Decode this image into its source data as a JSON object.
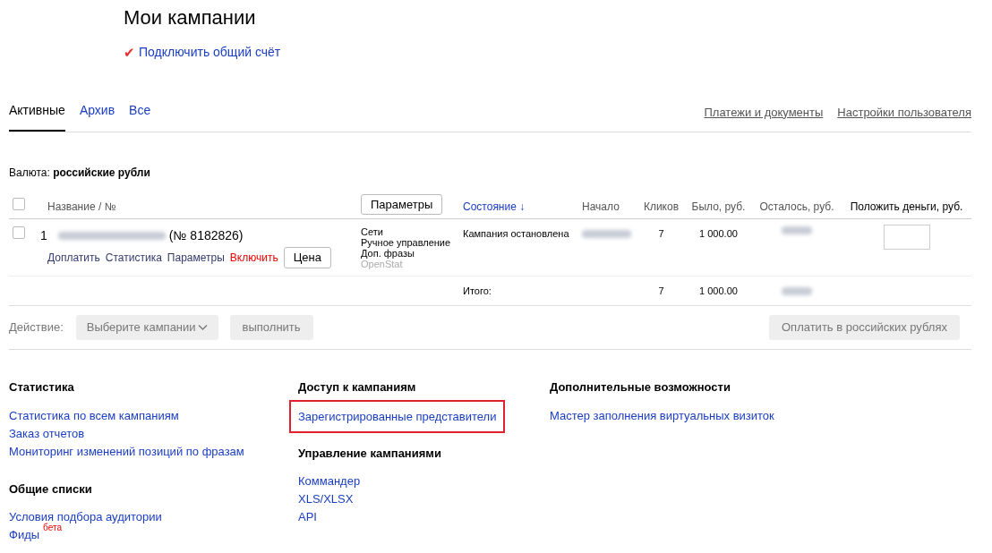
{
  "title": "Мои кампании",
  "connect_link": {
    "icon": "✔",
    "label": "Подключить общий счёт"
  },
  "tabs": [
    {
      "label": "Активные",
      "selected": true
    },
    {
      "label": "Архив",
      "selected": false
    },
    {
      "label": "Все",
      "selected": false
    }
  ],
  "header_links": [
    "Платежи и документы",
    "Настройки пользователя"
  ],
  "currency": {
    "label": "Валюта:",
    "value": "российские рубли"
  },
  "table": {
    "select_all_checked": false,
    "params_button": "Параметры",
    "columns": [
      "Название / №",
      "Состояние ↓",
      "Начало",
      "Кликов",
      "Было, руб.",
      "Осталось, руб.",
      "Положить деньги, руб."
    ],
    "rows": [
      {
        "checked": false,
        "index": "1",
        "number": "(№ 8182826)",
        "actions": [
          {
            "label": "Доплатить",
            "kind": "link"
          },
          {
            "label": "Статистика",
            "kind": "link"
          },
          {
            "label": "Параметры",
            "kind": "link"
          },
          {
            "label": "Включить",
            "kind": "warning"
          }
        ],
        "price_button": "Цена",
        "strategy": [
          {
            "text": "Сети",
            "disabled": false
          },
          {
            "text": "Ручное управление",
            "disabled": false
          },
          {
            "text": "Доп. фразы",
            "disabled": false
          },
          {
            "text": "OpenStat",
            "disabled": true
          }
        ],
        "status": "Кампания остановлена",
        "clicks": "7",
        "was": "1 000.00"
      }
    ],
    "total": {
      "label": "Итого:",
      "clicks": "7",
      "was": "1 000.00"
    }
  },
  "action_bar": {
    "label": "Действие:",
    "select": "Выберите кампании",
    "execute": "выполнить",
    "pay": "Оплатить в российских рублях"
  },
  "footer": [
    [
      {
        "heading": "Статистика",
        "links": [
          {
            "label": "Статистика по всем кампаниям",
            "highlighted": false
          },
          {
            "label": "Заказ отчетов",
            "highlighted": false
          },
          {
            "label": "Мониторинг изменений позиций по фразам",
            "highlighted": false
          }
        ]
      },
      {
        "heading": "Общие списки",
        "links": [
          {
            "label": "Условия подбора аудитории",
            "highlighted": false
          },
          {
            "label": "Фиды",
            "badge": "бета",
            "highlighted": false
          }
        ]
      }
    ],
    [
      {
        "heading": "Доступ к кампаниям",
        "links": [
          {
            "label": "Зарегистрированные представители",
            "highlighted": true
          }
        ]
      },
      {
        "heading": "Управление кампаниями",
        "links": [
          {
            "label": "Коммандер",
            "highlighted": false
          },
          {
            "label": "XLS/XLSX",
            "highlighted": false
          },
          {
            "label": "API",
            "highlighted": false
          }
        ]
      }
    ],
    [
      {
        "heading": "Дополнительные возможности",
        "links": [
          {
            "label": "Мастер заполнения виртуальных визиток",
            "highlighted": false
          }
        ]
      }
    ]
  ]
}
